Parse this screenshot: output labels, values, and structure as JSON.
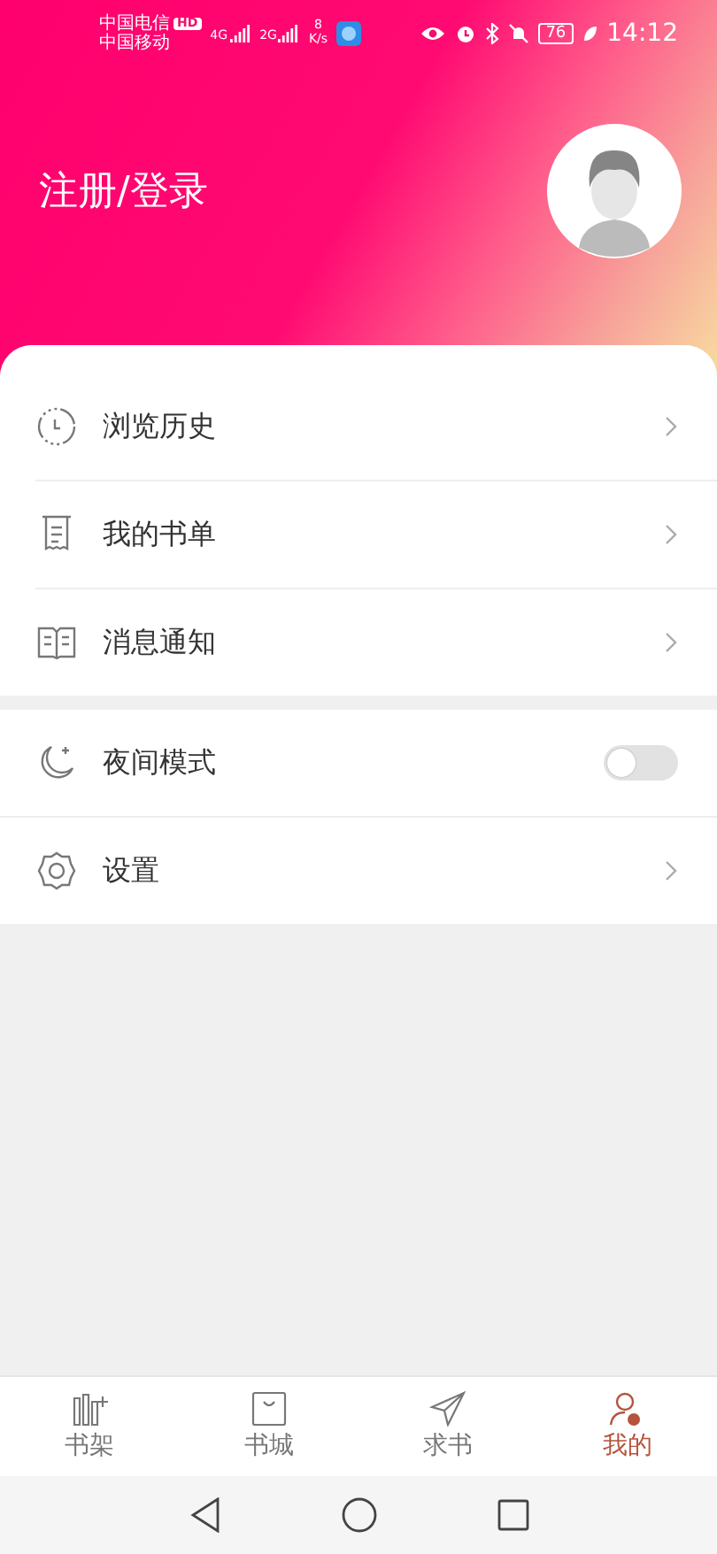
{
  "status_bar": {
    "carriers": [
      "中国电信",
      "中国移动"
    ],
    "hd": "HD",
    "signals": [
      "4G",
      "2G"
    ],
    "speed": [
      "8",
      "K/s"
    ],
    "battery": "76",
    "time": "14:12"
  },
  "header": {
    "login": "注册/登录"
  },
  "menu_groups": [
    {
      "items": [
        {
          "kind": "link",
          "label": "浏览历史"
        },
        {
          "kind": "link",
          "label": "我的书单"
        },
        {
          "kind": "link",
          "label": "消息通知"
        }
      ]
    },
    {
      "items": [
        {
          "kind": "toggle",
          "label": "夜间模式",
          "on": false
        },
        {
          "kind": "link",
          "label": "设置"
        }
      ]
    }
  ],
  "tabs": [
    {
      "label": "书架",
      "selected": false
    },
    {
      "label": "书城",
      "selected": false
    },
    {
      "label": "求书",
      "selected": false
    },
    {
      "label": "我的",
      "selected": true
    }
  ]
}
